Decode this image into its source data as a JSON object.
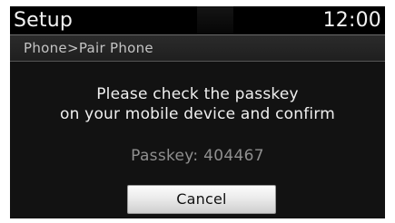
{
  "header": {
    "title": "Setup",
    "clock": "12:00"
  },
  "breadcrumb": {
    "text": "Phone>Pair Phone"
  },
  "dialog": {
    "message_lines": [
      "Please check the passkey",
      "on your mobile device and confirm"
    ],
    "passkey_text": "Passkey: 404467",
    "cancel_label": "Cancel"
  },
  "colors": {
    "screen_background": "#121212",
    "header_background": "#000000",
    "primary_text": "#f0f0f0",
    "secondary_text": "#8f8f8f",
    "button_background": "#ebebeb"
  }
}
